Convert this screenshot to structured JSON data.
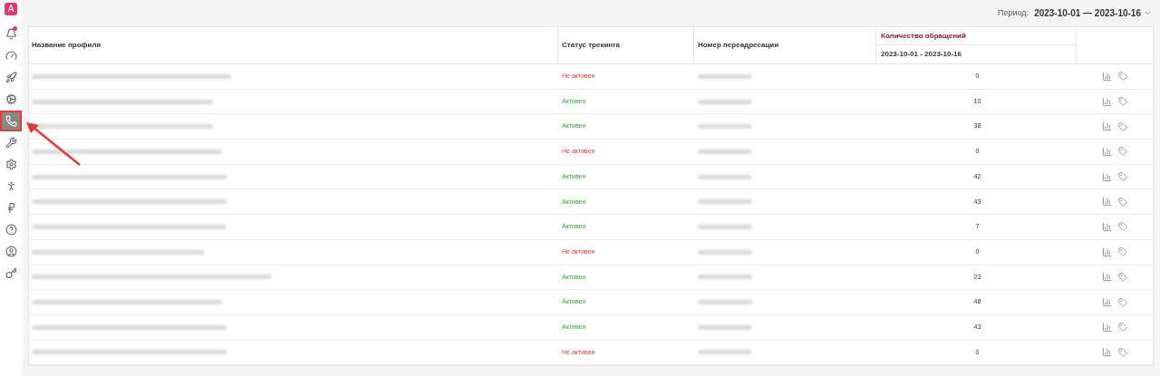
{
  "sidebar": {
    "logo": "A",
    "items": [
      {
        "kind": "bell",
        "badge": true,
        "selected": false
      },
      {
        "kind": "gauge",
        "badge": false,
        "selected": false
      },
      {
        "kind": "rocket",
        "badge": false,
        "selected": false
      },
      {
        "kind": "gears",
        "badge": false,
        "selected": false
      },
      {
        "kind": "phone",
        "badge": false,
        "selected": true
      },
      {
        "kind": "tools",
        "badge": false,
        "selected": false
      },
      {
        "kind": "gear",
        "badge": false,
        "selected": false
      },
      {
        "kind": "person",
        "badge": false,
        "selected": false
      },
      {
        "kind": "ruble",
        "badge": false,
        "selected": false
      },
      {
        "kind": "help",
        "badge": false,
        "selected": false
      },
      {
        "kind": "user",
        "badge": false,
        "selected": false
      },
      {
        "kind": "key",
        "badge": false,
        "selected": false
      }
    ]
  },
  "period": {
    "label": "Период:",
    "value": "2023-10-01 — 2023-10-16"
  },
  "table": {
    "columns": {
      "name": "Название профиля",
      "status": "Статус трекинга",
      "number": "Номер переадресации",
      "count": "Количество обращений",
      "count_sub": "2023-10-01 - 2023-10-16"
    },
    "rows": [
      {
        "status": "Не активен",
        "active": false,
        "count": "0"
      },
      {
        "status": "Активен",
        "active": true,
        "count": "10"
      },
      {
        "status": "Активен",
        "active": true,
        "count": "38"
      },
      {
        "status": "Не активен",
        "active": false,
        "count": "0"
      },
      {
        "status": "Активен",
        "active": true,
        "count": "42"
      },
      {
        "status": "Активен",
        "active": true,
        "count": "43"
      },
      {
        "status": "Активен",
        "active": true,
        "count": "7"
      },
      {
        "status": "Не активен",
        "active": false,
        "count": "0"
      },
      {
        "status": "Активен",
        "active": true,
        "count": "23"
      },
      {
        "status": "Активен",
        "active": true,
        "count": "48"
      },
      {
        "status": "Активен",
        "active": true,
        "count": "43"
      },
      {
        "status": "Не активен",
        "active": false,
        "count": "0"
      }
    ]
  }
}
